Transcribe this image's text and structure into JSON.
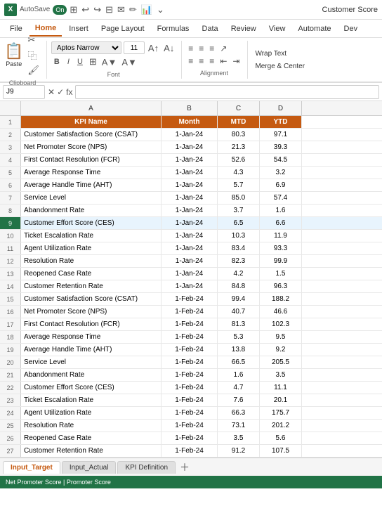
{
  "titleBar": {
    "excelLabel": "X",
    "autosave": "AutoSave",
    "toggleLabel": "On",
    "title": "Customer Score",
    "toolbarIcons": [
      "undo",
      "redo",
      "grid",
      "mail",
      "draw",
      "chart",
      "more"
    ]
  },
  "ribbonTabs": [
    "File",
    "Home",
    "Insert",
    "Page Layout",
    "Formulas",
    "Data",
    "Review",
    "View",
    "Automate",
    "Dev"
  ],
  "activeTab": "Home",
  "ribbon": {
    "paste": "Paste",
    "clipboard": "Clipboard",
    "font": "Font",
    "fontName": "Aptos Narrow",
    "fontSize": "11",
    "alignment": "Alignment",
    "wrapText": "Wrap Text",
    "mergeCenter": "Merge & Center"
  },
  "formulaBar": {
    "cellRef": "J9",
    "formula": ""
  },
  "columns": {
    "headers": [
      "A",
      "B",
      "C",
      "D"
    ],
    "widths": [
      200,
      80,
      60,
      60
    ],
    "labels": [
      "KPI Name",
      "Month",
      "MTD",
      "YTD"
    ]
  },
  "rows": [
    {
      "num": 2,
      "a": "Customer Satisfaction Score (CSAT)",
      "b": "1-Jan-24",
      "c": "80.3",
      "d": "97.1"
    },
    {
      "num": 3,
      "a": "Net Promoter Score (NPS)",
      "b": "1-Jan-24",
      "c": "21.3",
      "d": "39.3"
    },
    {
      "num": 4,
      "a": "First Contact Resolution (FCR)",
      "b": "1-Jan-24",
      "c": "52.6",
      "d": "54.5"
    },
    {
      "num": 5,
      "a": "Average Response Time",
      "b": "1-Jan-24",
      "c": "4.3",
      "d": "3.2"
    },
    {
      "num": 6,
      "a": "Average Handle Time (AHT)",
      "b": "1-Jan-24",
      "c": "5.7",
      "d": "6.9"
    },
    {
      "num": 7,
      "a": "Service Level",
      "b": "1-Jan-24",
      "c": "85.0",
      "d": "57.4"
    },
    {
      "num": 8,
      "a": "Abandonment Rate",
      "b": "1-Jan-24",
      "c": "3.7",
      "d": "1.6"
    },
    {
      "num": 9,
      "a": "Customer Effort Score (CES)",
      "b": "1-Jan-24",
      "c": "6.5",
      "d": "6.6",
      "selected": true
    },
    {
      "num": 10,
      "a": "Ticket Escalation Rate",
      "b": "1-Jan-24",
      "c": "10.3",
      "d": "11.9"
    },
    {
      "num": 11,
      "a": "Agent Utilization Rate",
      "b": "1-Jan-24",
      "c": "83.4",
      "d": "93.3"
    },
    {
      "num": 12,
      "a": "Resolution Rate",
      "b": "1-Jan-24",
      "c": "82.3",
      "d": "99.9"
    },
    {
      "num": 13,
      "a": "Reopened Case Rate",
      "b": "1-Jan-24",
      "c": "4.2",
      "d": "1.5"
    },
    {
      "num": 14,
      "a": "Customer Retention Rate",
      "b": "1-Jan-24",
      "c": "84.8",
      "d": "96.3"
    },
    {
      "num": 15,
      "a": "Customer Satisfaction Score (CSAT)",
      "b": "1-Feb-24",
      "c": "99.4",
      "d": "188.2"
    },
    {
      "num": 16,
      "a": "Net Promoter Score (NPS)",
      "b": "1-Feb-24",
      "c": "40.7",
      "d": "46.6"
    },
    {
      "num": 17,
      "a": "First Contact Resolution (FCR)",
      "b": "1-Feb-24",
      "c": "81.3",
      "d": "102.3"
    },
    {
      "num": 18,
      "a": "Average Response Time",
      "b": "1-Feb-24",
      "c": "5.3",
      "d": "9.5"
    },
    {
      "num": 19,
      "a": "Average Handle Time (AHT)",
      "b": "1-Feb-24",
      "c": "13.8",
      "d": "9.2"
    },
    {
      "num": 20,
      "a": "Service Level",
      "b": "1-Feb-24",
      "c": "66.5",
      "d": "205.5"
    },
    {
      "num": 21,
      "a": "Abandonment Rate",
      "b": "1-Feb-24",
      "c": "1.6",
      "d": "3.5"
    },
    {
      "num": 22,
      "a": "Customer Effort Score (CES)",
      "b": "1-Feb-24",
      "c": "4.7",
      "d": "11.1"
    },
    {
      "num": 23,
      "a": "Ticket Escalation Rate",
      "b": "1-Feb-24",
      "c": "7.6",
      "d": "20.1"
    },
    {
      "num": 24,
      "a": "Agent Utilization Rate",
      "b": "1-Feb-24",
      "c": "66.3",
      "d": "175.7"
    },
    {
      "num": 25,
      "a": "Resolution Rate",
      "b": "1-Feb-24",
      "c": "73.1",
      "d": "201.2"
    },
    {
      "num": 26,
      "a": "Reopened Case Rate",
      "b": "1-Feb-24",
      "c": "3.5",
      "d": "5.6"
    },
    {
      "num": 27,
      "a": "Customer Retention Rate",
      "b": "1-Feb-24",
      "c": "91.2",
      "d": "107.5"
    }
  ],
  "sheetTabs": [
    "Input_Target",
    "Input_Actual",
    "KPI Definition"
  ],
  "activeSheet": "Input_Target",
  "statusBar": {
    "text": "Net Promoter Score | Promoter Score"
  }
}
